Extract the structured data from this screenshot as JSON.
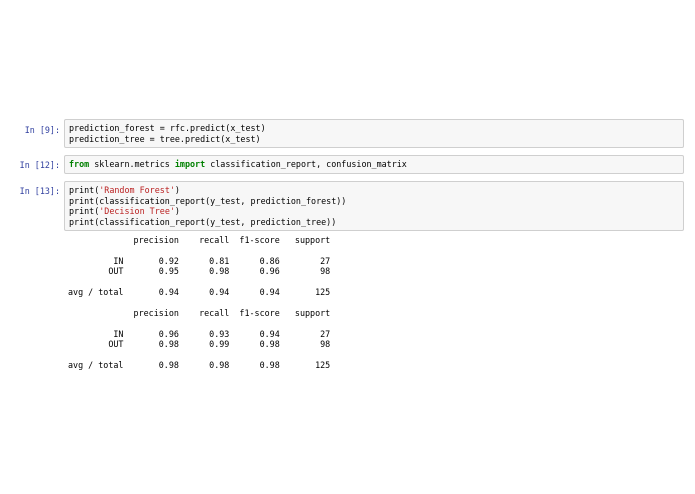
{
  "cells": [
    {
      "prompt": "In [9]:",
      "lines": [
        [
          {
            "t": "plain",
            "v": "prediction_forest = rfc.predict(x_test)"
          }
        ],
        [
          {
            "t": "plain",
            "v": "prediction_tree = tree.predict(x_test)"
          }
        ]
      ]
    },
    {
      "prompt": "In [12]:",
      "lines": [
        [
          {
            "t": "kw",
            "v": "from"
          },
          {
            "t": "plain",
            "v": " sklearn.metrics "
          },
          {
            "t": "kw",
            "v": "import"
          },
          {
            "t": "plain",
            "v": " classification_report, confusion_matrix"
          }
        ]
      ]
    },
    {
      "prompt": "In [13]:",
      "lines": [
        [
          {
            "t": "plain",
            "v": "print("
          },
          {
            "t": "str",
            "v": "'Random Forest'"
          },
          {
            "t": "plain",
            "v": ")"
          }
        ],
        [
          {
            "t": "plain",
            "v": "print(classification_report(y_test, prediction_forest))"
          }
        ],
        [
          {
            "t": "plain",
            "v": "print("
          },
          {
            "t": "str",
            "v": "'Decision Tree'"
          },
          {
            "t": "plain",
            "v": ")"
          }
        ],
        [
          {
            "t": "plain",
            "v": "print(classification_report(y_test, prediction_tree))"
          }
        ]
      ],
      "output": [
        "             precision    recall  f1-score   support",
        "",
        "         IN       0.92      0.81      0.86        27",
        "        OUT       0.95      0.98      0.96        98",
        "",
        "avg / total       0.94      0.94      0.94       125",
        "",
        "             precision    recall  f1-score   support",
        "",
        "         IN       0.96      0.93      0.94        27",
        "        OUT       0.98      0.99      0.98        98",
        "",
        "avg / total       0.98      0.98      0.98       125"
      ]
    }
  ]
}
